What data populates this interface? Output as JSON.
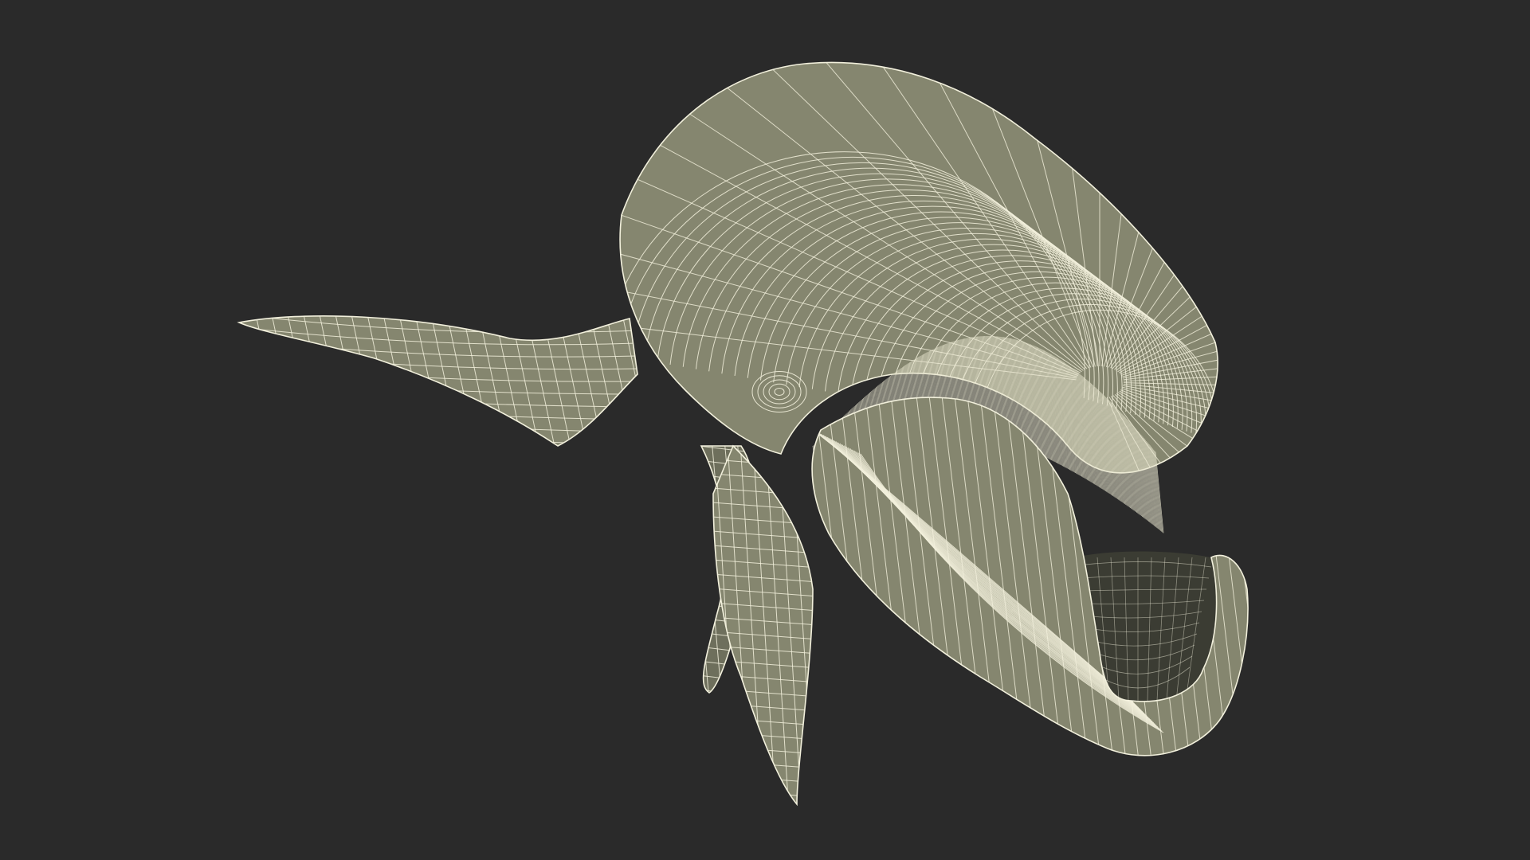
{
  "scene": {
    "subject": "",
    "colors": {
      "background": "#2a2a2a",
      "surface": "#85866f",
      "surface_shadow": "#6e6f5c",
      "wire": "#f2f0dc",
      "baleen": "#e8e6cf",
      "mouth_interior": "#3b3c33"
    }
  }
}
